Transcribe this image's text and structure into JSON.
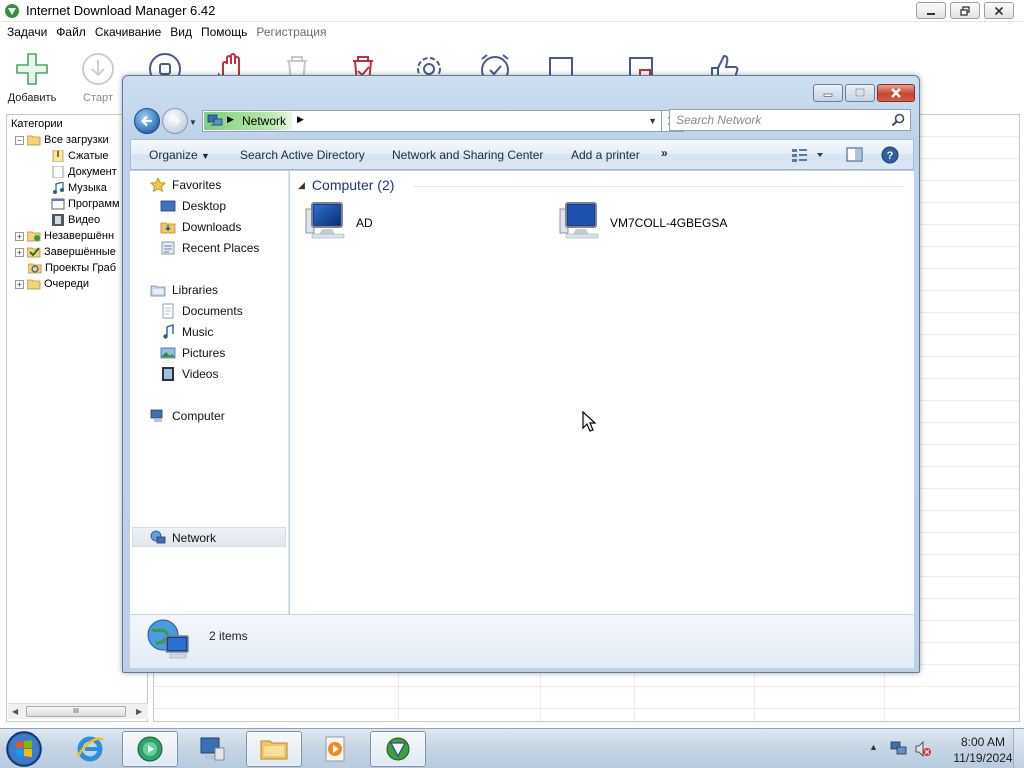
{
  "idm": {
    "title": "Internet Download Manager 6.42",
    "menu": [
      {
        "label": "Задачи",
        "disabled": false
      },
      {
        "label": "Файл",
        "disabled": false
      },
      {
        "label": "Скачивание",
        "disabled": false
      },
      {
        "label": "Вид",
        "disabled": false
      },
      {
        "label": "Помощь",
        "disabled": false
      },
      {
        "label": "Регистрация",
        "disabled": true
      }
    ],
    "toolbar": {
      "add_label": "Добавить",
      "start_label": "Старт"
    },
    "categories": {
      "header": "Категории",
      "items": [
        {
          "label": "Все загрузки"
        },
        {
          "label": "Сжатые"
        },
        {
          "label": "Документ"
        },
        {
          "label": "Музыка"
        },
        {
          "label": "Программ"
        },
        {
          "label": "Видео"
        },
        {
          "label": "Незавершённ"
        },
        {
          "label": "Завершённые"
        },
        {
          "label": "Проекты Граб"
        },
        {
          "label": "Очереди"
        }
      ]
    },
    "scroll_glyph": "III"
  },
  "explorer": {
    "address": {
      "crumb": "Network"
    },
    "search": {
      "placeholder": "Search Network"
    },
    "commands": {
      "organize": "Organize",
      "search_ad": "Search Active Directory",
      "network_center": "Network and Sharing Center",
      "add_printer": "Add a printer",
      "more": "»"
    },
    "navpane": {
      "favorites": "Favorites",
      "desktop": "Desktop",
      "downloads": "Downloads",
      "recent": "Recent Places",
      "libraries": "Libraries",
      "documents": "Documents",
      "music": "Music",
      "pictures": "Pictures",
      "videos": "Videos",
      "computer": "Computer",
      "network": "Network"
    },
    "group": {
      "title": "Computer (2)"
    },
    "computers": [
      {
        "name": "AD"
      },
      {
        "name": "VM7COLL-4GBEGSA"
      }
    ],
    "details": {
      "count": "2 items"
    }
  },
  "taskbar": {
    "clock_time": "8:00 AM",
    "clock_date": "11/19/2024"
  },
  "colors": {
    "explorer_frame": "#bfd3e8",
    "group_title": "#1e3287",
    "address_highlight": "#7bd27b",
    "close_button": "#c7452a"
  }
}
